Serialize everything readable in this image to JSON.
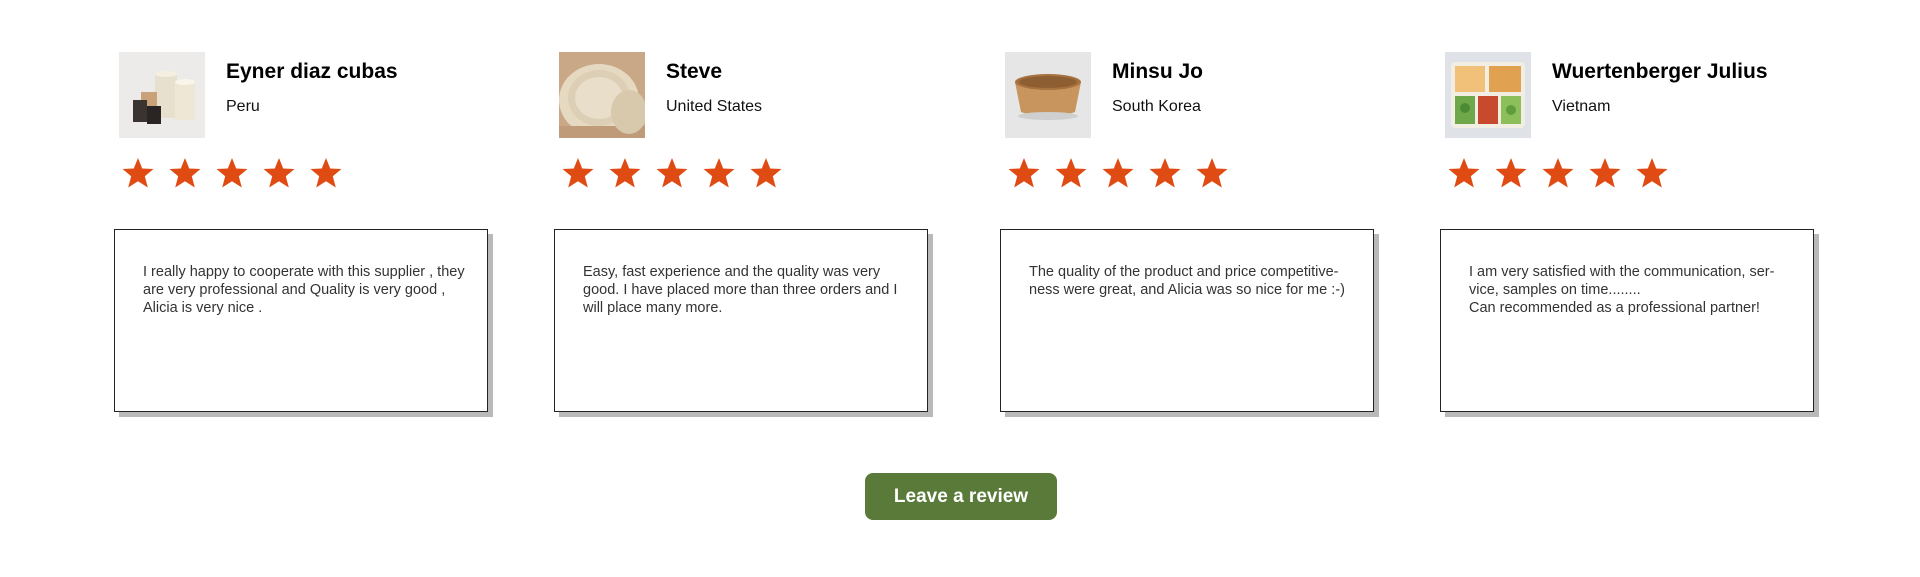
{
  "colors": {
    "star": "#e04a13",
    "button_bg": "#5a7a3a",
    "button_text": "#ffffff",
    "shadow": "#b9b9b9"
  },
  "reviews": [
    {
      "name": "Eyner diaz cubas",
      "country": "Peru",
      "rating": 5,
      "image_icon": "paper-cups-photo",
      "text": "I really happy to cooperate with this supplier , they are very professional and Quality is very good , Alicia is very nice ."
    },
    {
      "name": "Steve",
      "country": "United States",
      "rating": 5,
      "image_icon": "bagasse-plates-photo",
      "text": "Easy, fast experience and the quality was very good. I have placed more than three orders and I will place many more."
    },
    {
      "name": "Minsu Jo",
      "country": "South Korea",
      "rating": 5,
      "image_icon": "kraft-bowl-photo",
      "text": "The quality of the product and price competitive-ness were great, and Alicia was so nice for me :-)"
    },
    {
      "name": "Wuertenberger Julius",
      "country": "Vietnam",
      "rating": 5,
      "image_icon": "food-container-photo",
      "text": "I am very satisfied with the communication, ser-vice, samples on time........\nCan recommended as a professional partner!"
    }
  ],
  "leave_review_label": "Leave a review"
}
